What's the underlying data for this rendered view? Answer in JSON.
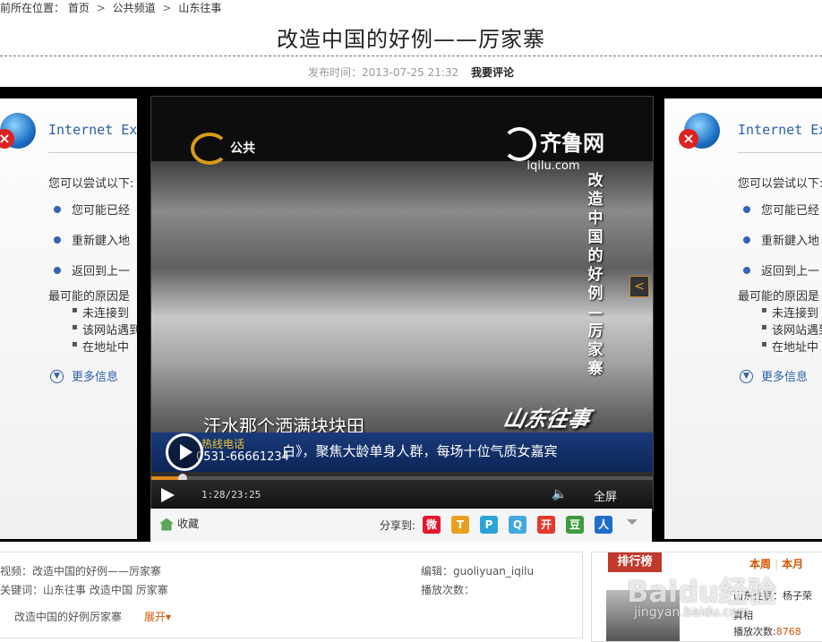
{
  "breadcrumb": {
    "prefix": "前所在位置：",
    "items": [
      "首页",
      "公共频道",
      "山东往事"
    ],
    "separator": ">"
  },
  "article": {
    "title": "改造中国的好例——厉家寨",
    "publish_label": "发布时间：2013-07-25 21:32",
    "comment_link": "我要评论"
  },
  "ie_error": {
    "title": "Internet Ex",
    "try_text": "您可以尝试以下:",
    "options": [
      "您可能已经",
      "重新鍵入地",
      "返回到上一"
    ],
    "reason_label": "最可能的原因是",
    "reasons": [
      "未连接到",
      "该网站遇到",
      "在地址中"
    ],
    "more_info": "更多信息"
  },
  "video": {
    "channel_logo": "公共",
    "site_logo_main": "齐鲁网",
    "site_logo_sub": "iqilu.com",
    "vertical_title": "改造中国的好例—厉家寨",
    "side_tab": "<",
    "subtitle": "汗水那个洒满块块田",
    "program_logo": "山东往事",
    "hotline_label": "热线电话",
    "hotline_number": "0531-66661234",
    "ticker": "白》，聚焦大龄单身人群，每场十位气质女嘉宾",
    "time_display": "1:28/23:25",
    "progress": 0.0627,
    "fullscreen_label": "全屏"
  },
  "sharebar": {
    "favorite_label": "收藏",
    "share_label": "分享到:",
    "services": [
      {
        "name": "weibo",
        "glyph": "微",
        "color": "#e6162d"
      },
      {
        "name": "tencent-weibo",
        "glyph": "T",
        "color": "#e8a01e"
      },
      {
        "name": "renren",
        "glyph": "P",
        "color": "#2aa4d8"
      },
      {
        "name": "qzone",
        "glyph": "Q",
        "color": "#3fa9e0"
      },
      {
        "name": "kaixin",
        "glyph": "开",
        "color": "#e4392b"
      },
      {
        "name": "douban",
        "glyph": "豆",
        "color": "#3c9b3c"
      },
      {
        "name": "people",
        "glyph": "人",
        "color": "#1f6fc9"
      }
    ]
  },
  "info": {
    "video_label": "视频：改造中国的好例——厉家寨",
    "keywords_label": "关键词：",
    "keywords": [
      "山东往事",
      "改造中国",
      "厉家寨"
    ],
    "related_title": "改造中国的好例厉家寨",
    "expand_label": "展开",
    "editor_label": "编辑：guoliyuan_iqilu",
    "plays_label": "播放次数："
  },
  "ranking": {
    "tab_label": "排行榜",
    "period_week": "本周",
    "period_month": "本月",
    "item_title": "山东往事：杨子荣",
    "item_subtitle": "真相",
    "item_plays_label": "播放次数:",
    "item_plays": "8768"
  },
  "watermark": {
    "brand": "Baidu经验",
    "url": "jingyan.baidu.com"
  },
  "colors": {
    "accent_orange": "#e08a1e",
    "ie_blue": "#2a5fa8",
    "rank_red": "#c0392b"
  }
}
